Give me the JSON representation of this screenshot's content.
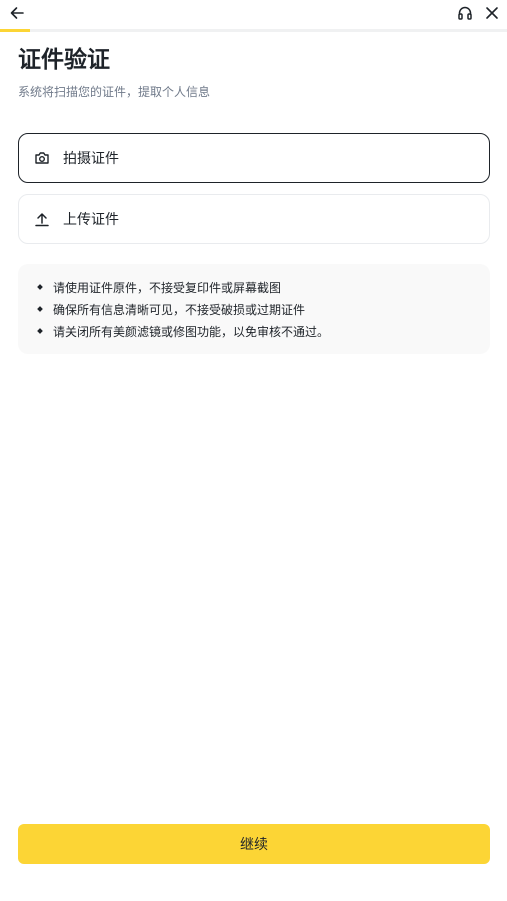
{
  "header": {
    "back_icon": "arrow-left-icon",
    "support_icon": "headset-icon",
    "close_icon": "close-icon",
    "progress_fraction": 0.06,
    "progress_color": "#fcd535"
  },
  "page": {
    "title": "证件验证",
    "subtitle": "系统将扫描您的证件，提取个人信息"
  },
  "options": [
    {
      "label": "拍摄证件",
      "icon": "camera-icon",
      "selected": true
    },
    {
      "label": "上传证件",
      "icon": "upload-icon",
      "selected": false
    }
  ],
  "tips": [
    "请使用证件原件，不接受复印件或屏幕截图",
    "确保所有信息清晰可见，不接受破损或过期证件",
    "请关闭所有美颜滤镜或修图功能，以免审核不通过。"
  ],
  "footer": {
    "continue_label": "继续",
    "accent_color": "#fcd535"
  }
}
